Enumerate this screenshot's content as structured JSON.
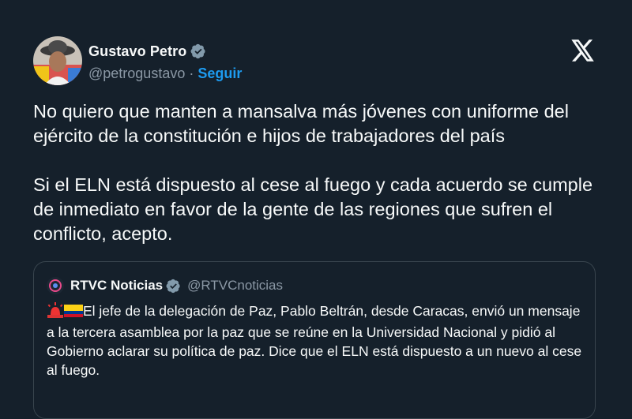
{
  "author": {
    "display_name": "Gustavo Petro",
    "handle": "@petrogustavo",
    "separator": "·",
    "follow_label": "Seguir"
  },
  "platform_icon": "x-logo-icon",
  "tweet": {
    "paragraphs": [
      "No quiero que manten a mansalva más jóvenes con uniforme del ejército de la constitución e hijos de trabajadores del país",
      "Si el ELN está dispuesto al cese al fuego y cada acuerdo se cumple de inmediato en favor de la gente de las regiones que sufren el conflicto, acepto."
    ]
  },
  "quoted_tweet": {
    "display_name": "RTVC Noticias",
    "handle": "@RTVCnoticias",
    "text": "El jefe de la delegación de Paz, Pablo Beltrán, desde Caracas, envió un mensaje a la tercera asamblea por la paz que se reúne en la Universidad Nacional y pidió al Gobierno aclarar su política de paz. Dice que el ELN está dispuesto a un nuevo al cese al fuego."
  },
  "colors": {
    "background": "#15202b",
    "text": "#f7f9f9",
    "secondary_text": "#8b98a5",
    "accent": "#1d9bf0",
    "border": "#38444d",
    "verified_badge": "#829aab"
  }
}
